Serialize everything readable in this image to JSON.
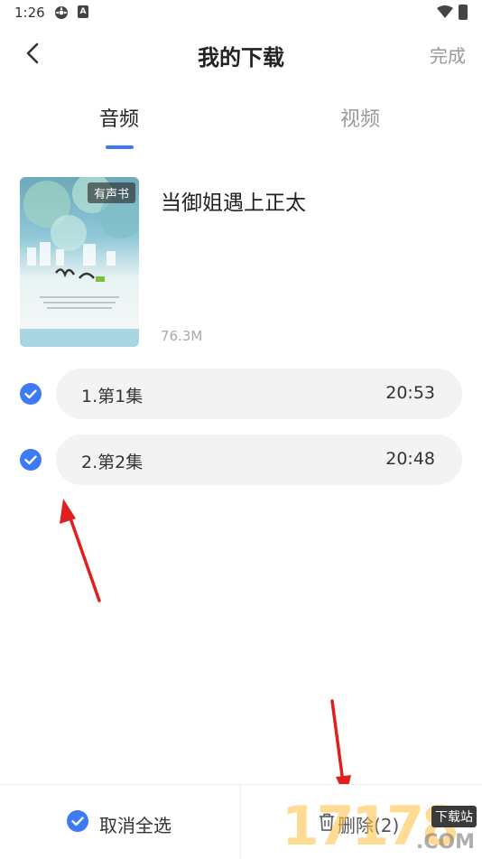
{
  "status": {
    "time": "1:26",
    "icon2": "A"
  },
  "header": {
    "title": "我的下载",
    "done_label": "完成"
  },
  "tabs": [
    {
      "label": "音频",
      "active": true
    },
    {
      "label": "视频",
      "active": false
    }
  ],
  "book": {
    "badge": "有声书",
    "title": "当御姐遇上正太",
    "size": "76.3M"
  },
  "episodes": [
    {
      "name": "1.第1集",
      "duration": "20:53",
      "checked": true
    },
    {
      "name": "2.第2集",
      "duration": "20:48",
      "checked": true
    }
  ],
  "bottom": {
    "deselect_label": "取消全选",
    "delete_label": "删除(2)"
  },
  "watermark": {
    "digits": "17178",
    "tag": "下载站",
    "domain": ".COM"
  },
  "colors": {
    "accent": "#3c7af6",
    "arrow": "#e0201e"
  }
}
